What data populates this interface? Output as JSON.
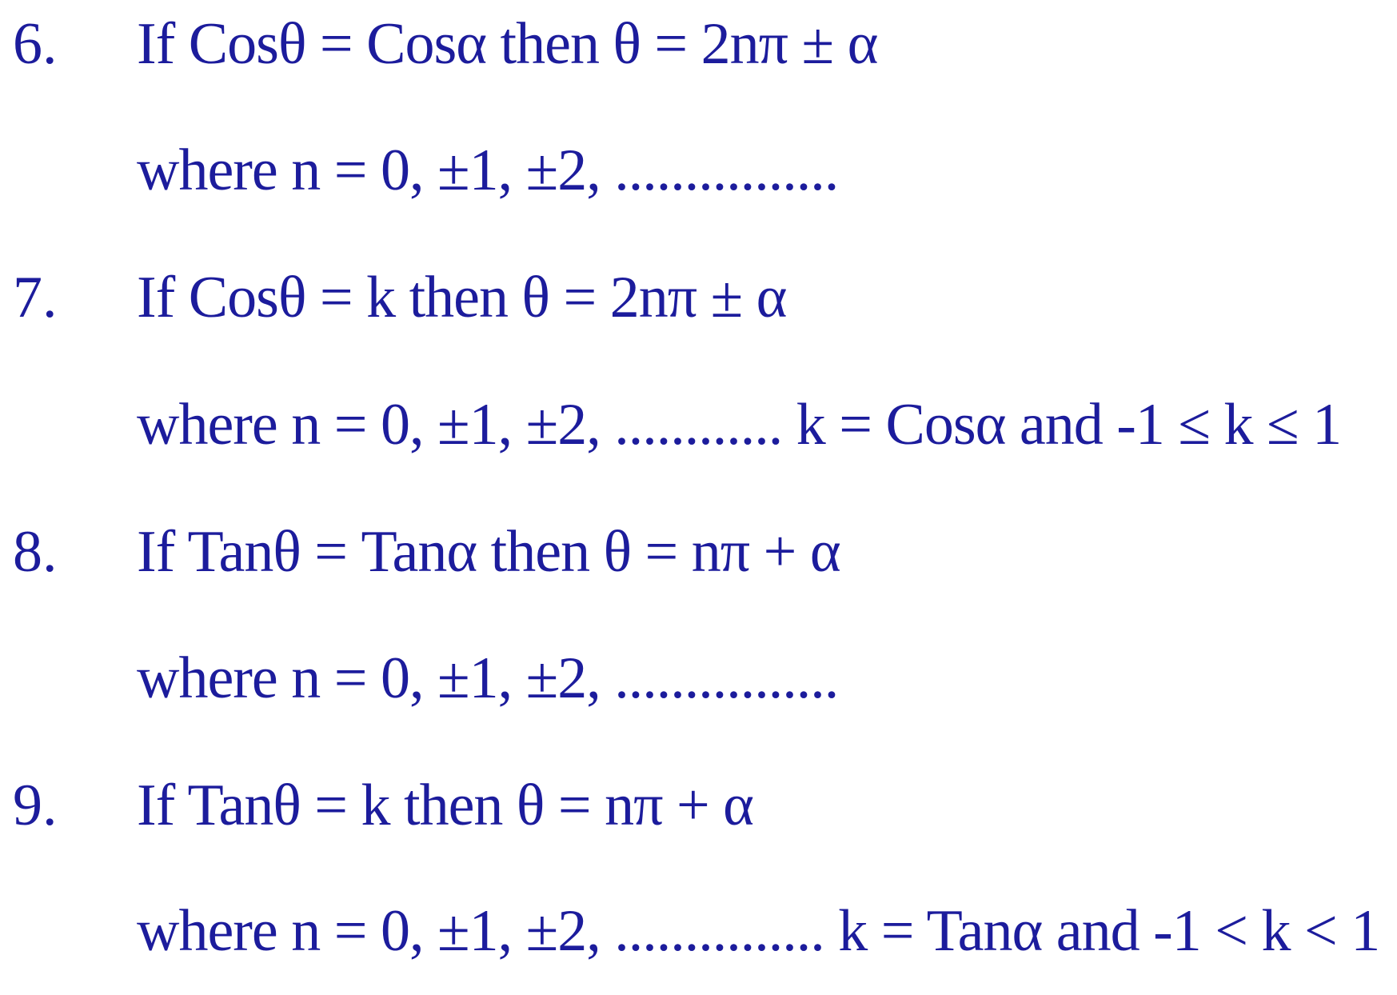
{
  "text_color": "#1c1c9c",
  "items": [
    {
      "number": "6.",
      "statement": "If  Cosθ = Cosα  then θ = 2nπ ± α",
      "condition": "where  n = 0, ±1, ±2, ................"
    },
    {
      "number": "7.",
      "statement": "If  Cosθ = k  then θ = 2nπ ± α",
      "condition": "where  n = 0, ±1, ±2, ............ k = Cosα and -1 ≤ k ≤ 1"
    },
    {
      "number": "8.",
      "statement": "If  Tanθ = Tanα  then θ = nπ + α",
      "condition": "where  n = 0, ±1, ±2, ................"
    },
    {
      "number": "9.",
      "statement": "If  Tanθ = k  then θ = nπ + α",
      "condition": "where  n = 0, ±1, ±2, ............... k = Tanα and -1 < k < 1"
    }
  ]
}
